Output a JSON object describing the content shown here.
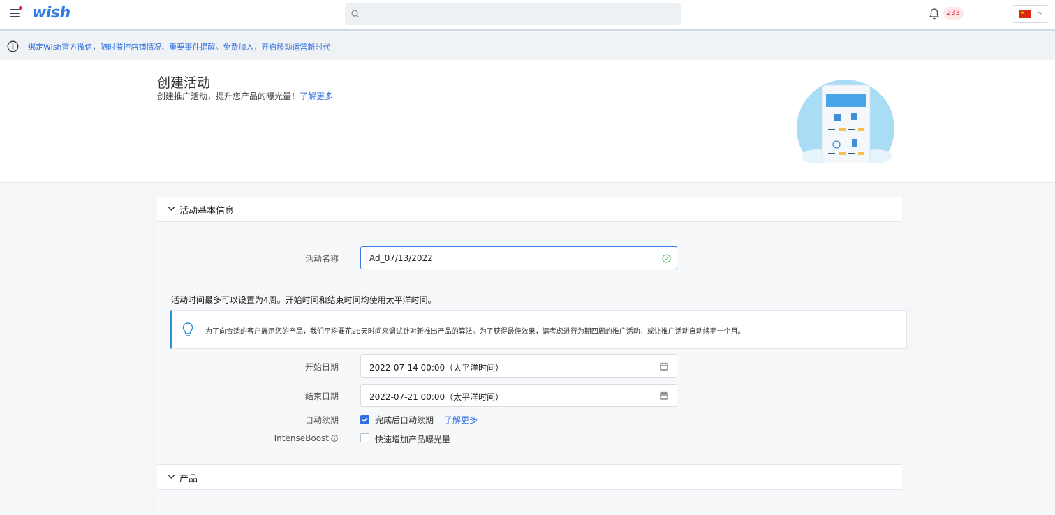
{
  "header": {
    "logo": "wish",
    "search": {
      "placeholder": "",
      "value": ""
    },
    "notification_count": "233",
    "language_flag": "cn-flag",
    "flag_mark": "★"
  },
  "notice": {
    "text": "绑定Wish官方微信，随时监控店铺情况、重要事件提醒。免费加入，开启移动运营新时代"
  },
  "page": {
    "title": "创建活动",
    "subtitle": "创建推广活动，提升您产品的曝光量！",
    "learn_more": "了解更多"
  },
  "section_basic": {
    "header": "活动基本信息",
    "name_label": "活动名称",
    "name_value": "Ad_07/13/2022",
    "rule_text": "活动时间最多可以设置为4周。开始时间和结束时间均使用太平洋时间。",
    "tip_text": "为了向合适的客户展示您的产品，我们平均要花28天时间来调试针对新推出产品的算法。为了获得最佳效果，请考虑进行为期四周的推广活动，或让推广活动自动续期一个月。",
    "start_label": "开始日期",
    "start_value": "2022-07-14 00:00（太平洋时间）",
    "end_label": "结束日期",
    "end_value": "2022-07-21 00:00（太平洋时间）",
    "auto_renew_label": "自动续期",
    "auto_renew_checkbox_label": "完成后自动续期",
    "auto_renew_checked": true,
    "auto_renew_link": "了解更多",
    "boost_label": "IntenseBoost",
    "boost_checkbox_label": "快速增加产品曝光量",
    "boost_checked": false
  },
  "section_products": {
    "header": "产品"
  },
  "colors": {
    "accent": "#2f6fe0",
    "brand": "#2f7de1",
    "badge": "#e0223b",
    "tip_border": "#2b8fd6"
  }
}
